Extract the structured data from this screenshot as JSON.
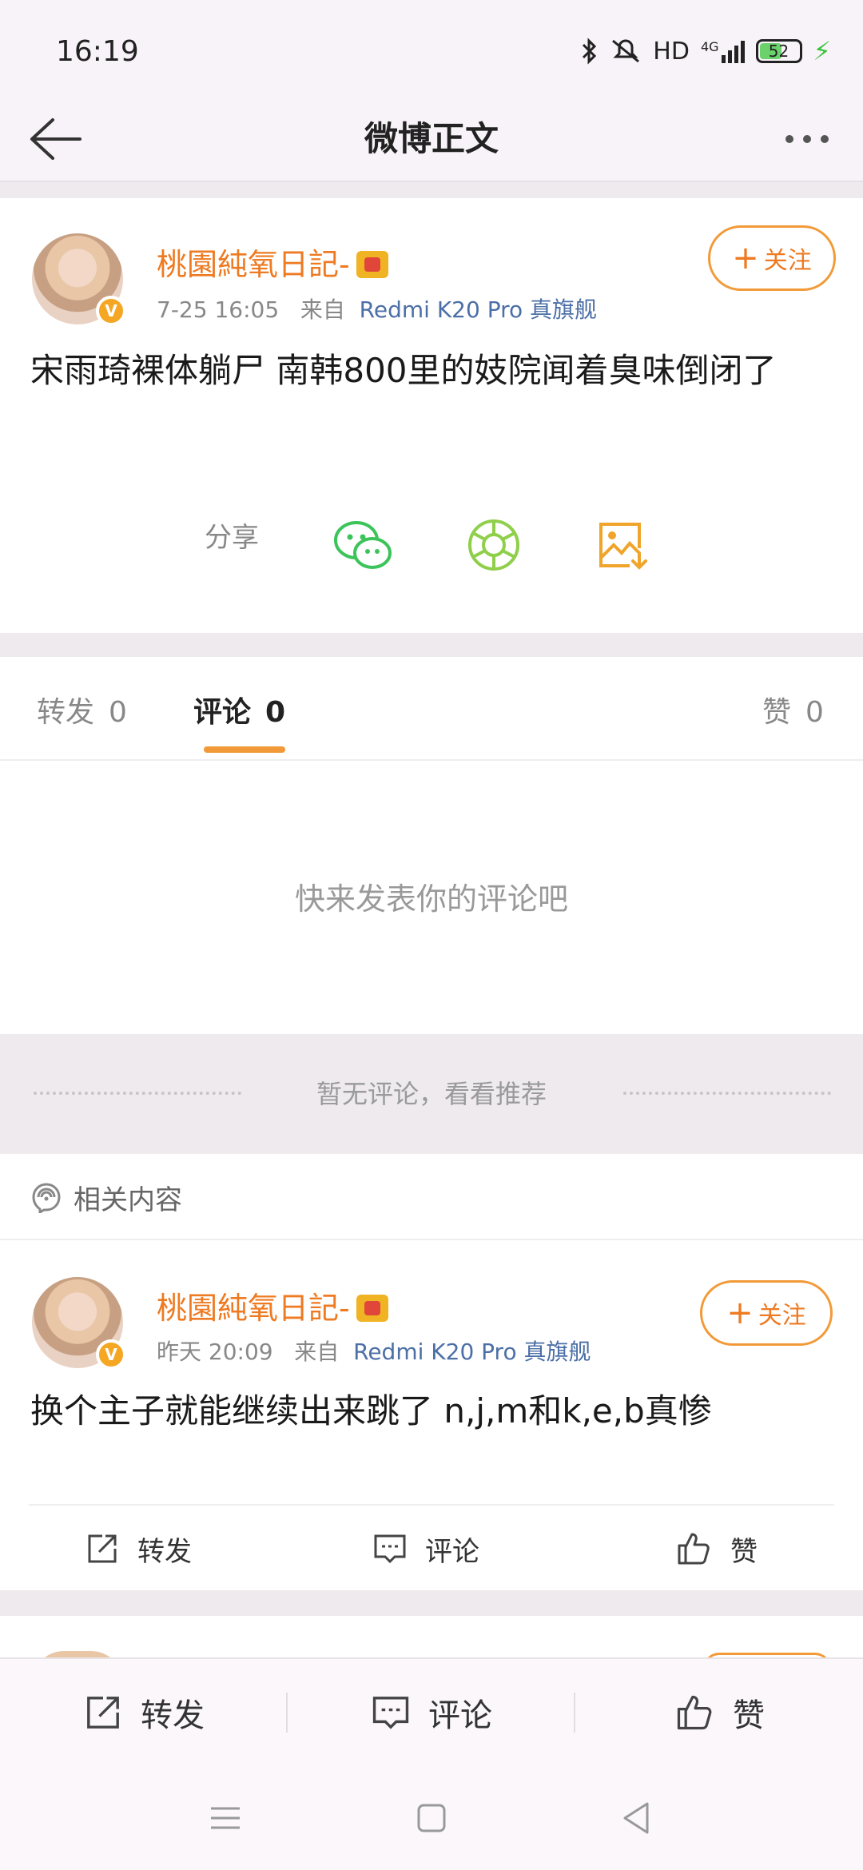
{
  "status_bar": {
    "time": "16:19",
    "network_label": "HD",
    "signal_label": "4G",
    "battery": "52"
  },
  "header": {
    "title": "微博正文"
  },
  "post": {
    "author": "桃園純氧日記-",
    "time": "7-25 16:05",
    "source_prefix": "来自",
    "source": "Redmi K20 Pro 真旗舰",
    "follow_label": "关注",
    "text": "宋雨琦裸体躺尸 南韩800里的妓院闻着臭味倒闭了",
    "share_label": "分享",
    "share_icons": [
      "wechat-icon",
      "moments-icon",
      "save-image-icon"
    ]
  },
  "tabs": [
    {
      "label": "转发",
      "count": "0"
    },
    {
      "label": "评论",
      "count": "0"
    },
    {
      "label": "赞",
      "count": "0"
    }
  ],
  "comments": {
    "empty_text": "快来发表你的评论吧",
    "no_comment_text": "暂无评论，看看推荐"
  },
  "related": {
    "label": "相关内容",
    "card": {
      "author": "桃園純氧日記-",
      "time": "昨天 20:09",
      "source_prefix": "来自",
      "source": "Redmi K20 Pro 真旗舰",
      "follow_label": "关注",
      "text": "换个主子就能继续出来跳了 n,j,m和k,e,b真惨",
      "actions": [
        "转发",
        "评论",
        "赞"
      ]
    }
  },
  "bottom_bar": {
    "repost": "转发",
    "comment": "评论",
    "like": "赞"
  },
  "colors": {
    "accent": "#f29a38",
    "username": "#ee7a22",
    "source": "#4b6fa6",
    "background": "#f8f3f8"
  }
}
